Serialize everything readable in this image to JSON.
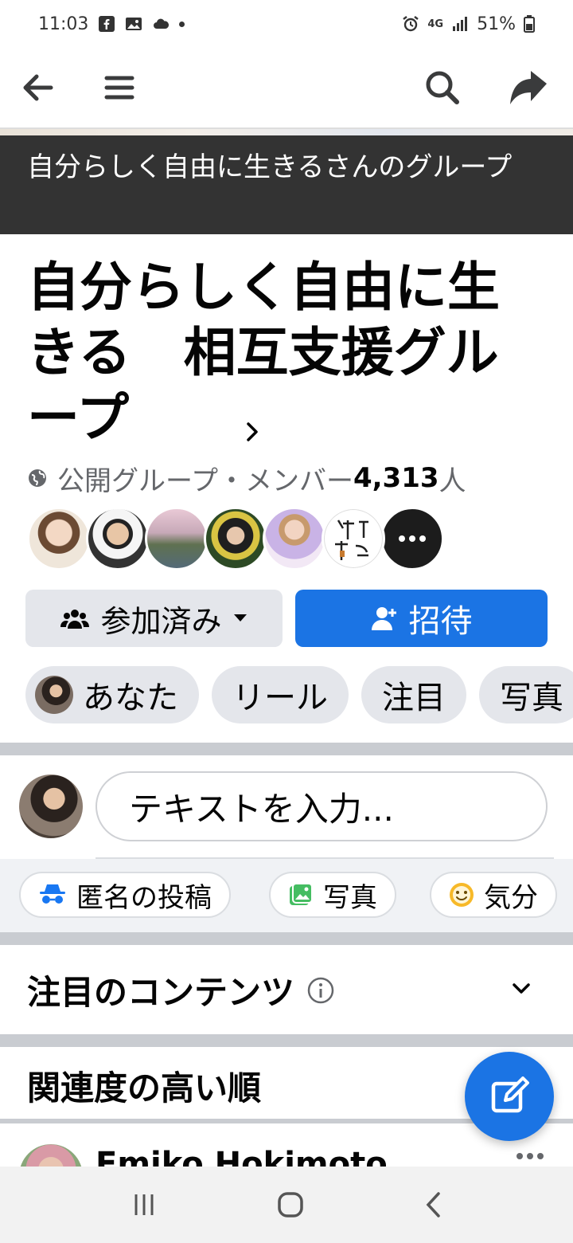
{
  "status_bar": {
    "time": "11:03",
    "battery": "51%",
    "network": "4G"
  },
  "banner": {
    "text": "自分らしく自由に生きるさんのグループ"
  },
  "group": {
    "title": "自分らしく自由に生きる　相互支援グループ",
    "privacy": "公開グループ・メンバー",
    "member_count": "4,313",
    "member_unit": "人",
    "more_members_icon": "more-dots-icon"
  },
  "buttons": {
    "joined": "参加済み",
    "invite": "招待"
  },
  "tabs": [
    {
      "label": "あなた"
    },
    {
      "label": "リール"
    },
    {
      "label": "注目"
    },
    {
      "label": "写真"
    }
  ],
  "composer": {
    "placeholder": "テキストを入力..."
  },
  "post_actions": [
    {
      "label": "匿名の投稿",
      "icon": "anonymous-icon"
    },
    {
      "label": "写真",
      "icon": "photo-icon"
    },
    {
      "label": "気分",
      "icon": "feeling-icon"
    }
  ],
  "sections": {
    "featured": "注目のコンテンツ",
    "sort": "関連度の高い順"
  },
  "post": {
    "author": "Emiko Hokimoto"
  },
  "colors": {
    "primary": "#1b74e4",
    "banner_bg": "#333333",
    "pill_bg": "#e4e6eb"
  }
}
